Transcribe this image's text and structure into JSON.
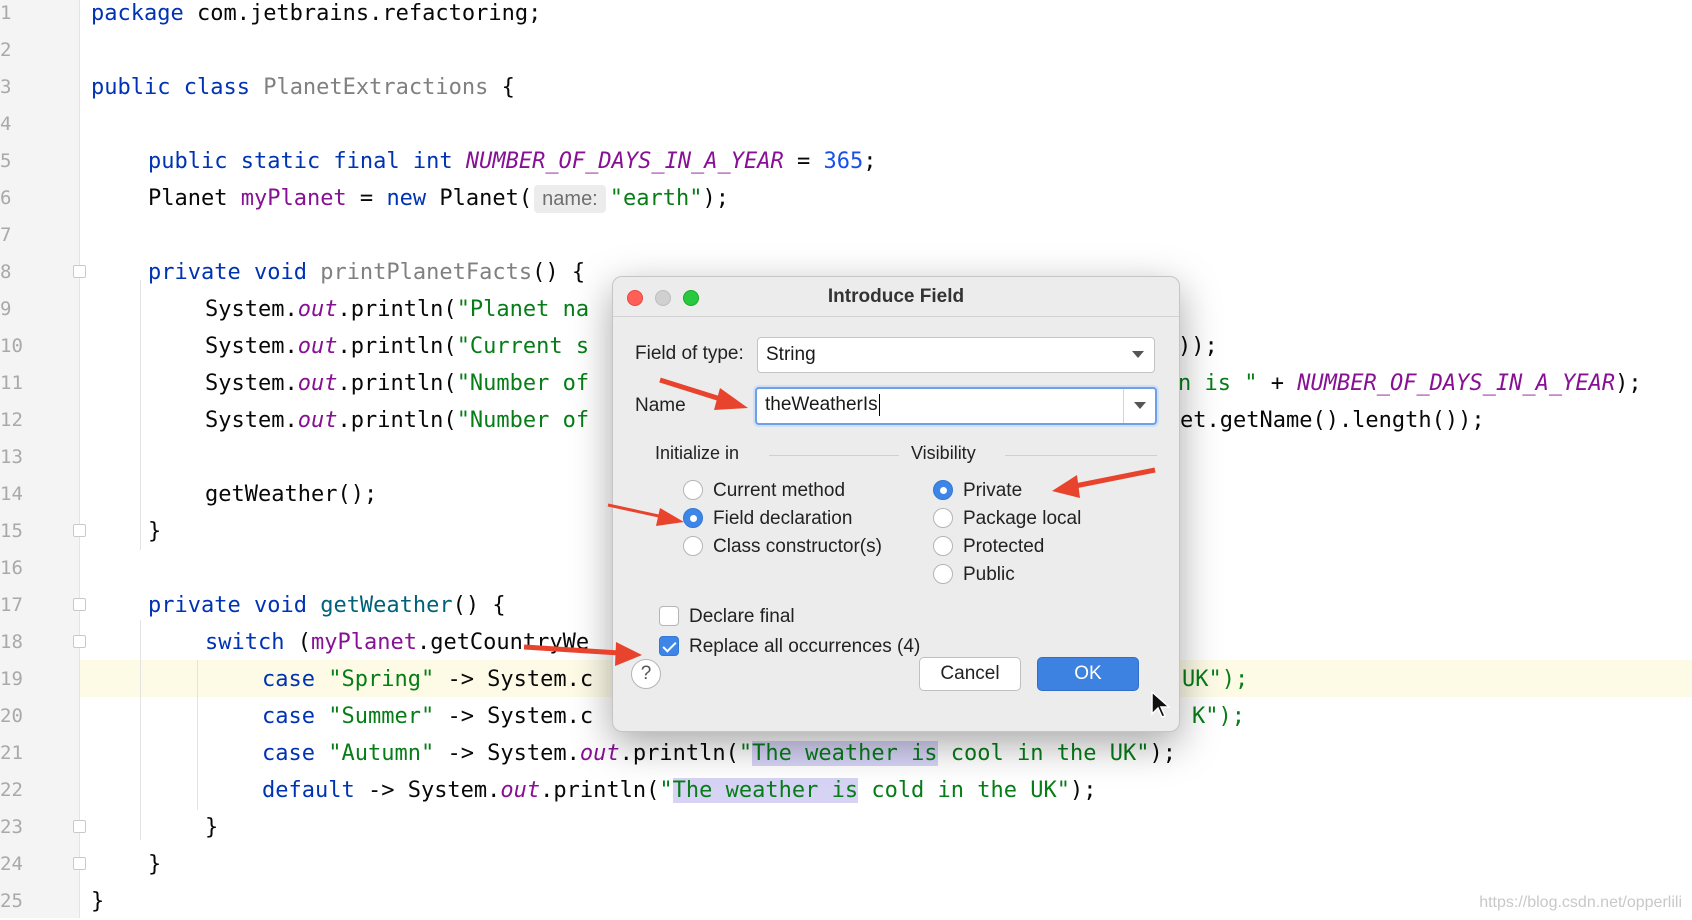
{
  "editor": {
    "line_numbers": [
      "1",
      "2",
      "3",
      "4",
      "5",
      "6",
      "7",
      "8",
      "9",
      "10",
      "11",
      "12",
      "13",
      "14",
      "15",
      "16",
      "17",
      "18",
      "19",
      "20",
      "21",
      "22",
      "23",
      "24",
      "25"
    ],
    "lines": {
      "l1_kw": "package",
      "l1_rest": " com.jetbrains.refactoring;",
      "l3_kw": "public class",
      "l3_name": " PlanetExtractions",
      "l3_rest": " {",
      "l5_kw": "public static final int",
      "l5_const": "NUMBER_OF_DAYS_IN_A_YEAR",
      "l5_eq": " = ",
      "l5_num": "365",
      "l5_end": ";",
      "l6_type": "Planet ",
      "l6_field": "myPlanet",
      "l6_mid": " = ",
      "l6_new": "new",
      "l6_call": " Planet(",
      "l6_hint": "name:",
      "l6_str": "\"earth\"",
      "l6_end": ");",
      "l8_kw": "private void",
      "l8_name": " printPlanetFacts",
      "l8_rest": "() {",
      "l9_a": "System.",
      "l9_out": "out",
      "l9_b": ".println(",
      "l9_str": "\"Planet na",
      "l10_a": "System.",
      "l10_out": "out",
      "l10_b": ".println(",
      "l10_str": "\"Current s",
      "l10_tail": "));",
      "l11_a": "System.",
      "l11_out": "out",
      "l11_b": ".println(",
      "l11_str": "\"Number of",
      "l11_tail_str": "n is \"",
      "l11_tail_mid": " + ",
      "l11_tail_const": "NUMBER_OF_DAYS_IN_A_YEAR",
      "l11_tail_end": ");",
      "l12_a": "System.",
      "l12_out": "out",
      "l12_b": ".println(",
      "l12_str": "\"Number of",
      "l12_tail": "et.getName().length());",
      "l14": "getWeather();",
      "l15": "}",
      "l17_kw": "private void",
      "l17_name": " getWeather",
      "l17_rest": "() {",
      "l18_kw": "switch",
      "l18_a": " (",
      "l18_field": "myPlanet",
      "l18_b": ".getCountryWe",
      "l19_kw": "case",
      "l19_str": " \"Spring\"",
      "l19_b": " -> System.c",
      "l19_tail": "UK\");",
      "l20_kw": "case",
      "l20_str": " \"Summer\"",
      "l20_b": " -> System.c",
      "l20_tail": "K\");",
      "l21_kw": "case",
      "l21_str": " \"Autumn\"",
      "l21_b": " -> System.",
      "l21_out": "out",
      "l21_c": ".println(",
      "l21_q": "\"",
      "l21_sel": "The weather is",
      "l21_rest": " cool in the UK\"",
      "l21_end": ");",
      "l22_kw": "default",
      "l22_b": " -> System.",
      "l22_out": "out",
      "l22_c": ".println(",
      "l22_q": "\"",
      "l22_sel": "The weather is",
      "l22_rest": " cold in the UK\"",
      "l22_end": ");",
      "l23": "}",
      "l24": "}",
      "l25": "}"
    }
  },
  "dialog": {
    "title": "Introduce Field",
    "field_of_type_label": "Field of type:",
    "field_of_type_value": "String",
    "name_label": "Name",
    "name_value": "theWeatherIs",
    "initialize_in_label": "Initialize in",
    "initialize_options": [
      "Current method",
      "Field declaration",
      "Class constructor(s)"
    ],
    "initialize_selected": "Field declaration",
    "visibility_label": "Visibility",
    "visibility_options": [
      "Private",
      "Package local",
      "Protected",
      "Public"
    ],
    "visibility_selected": "Private",
    "declare_final_label": "Declare final",
    "declare_final_checked": false,
    "replace_all_label": "Replace all occurrences (4)",
    "replace_all_checked": true,
    "help_label": "?",
    "cancel_label": "Cancel",
    "ok_label": "OK"
  },
  "watermark": "https://blog.csdn.net/opperlili",
  "colors": {
    "accent": "#3d82e0",
    "annotation_arrow": "#e8432d",
    "selection": "#d6d3f5"
  }
}
